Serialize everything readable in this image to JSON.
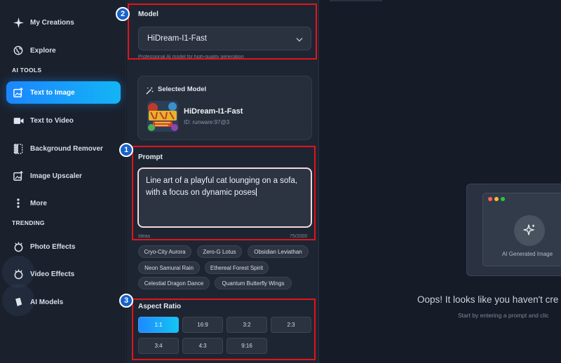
{
  "sidebar": {
    "items": [
      {
        "label": "My Creations",
        "icon": "sparkle-icon"
      },
      {
        "label": "Explore",
        "icon": "globe-icon"
      },
      {
        "label": "Text to Image",
        "icon": "image-add-icon",
        "active": true
      },
      {
        "label": "Text to Video",
        "icon": "video-icon"
      },
      {
        "label": "Background Remover",
        "icon": "bg-remove-icon"
      },
      {
        "label": "Image Upscaler",
        "icon": "upscale-icon"
      },
      {
        "label": "More",
        "icon": "more-vertical-icon"
      },
      {
        "label": "Photo Effects",
        "icon": "effects-icon"
      },
      {
        "label": "Video Effects",
        "icon": "effects-icon"
      },
      {
        "label": "AI Models",
        "icon": "model-cube-icon"
      }
    ],
    "section_ai_tools": "AI TOOLS",
    "section_trending": "TRENDING"
  },
  "model": {
    "label": "Model",
    "selected": "HiDream-I1-Fast",
    "description": "Professional AI model for high-quality generation"
  },
  "selected_model": {
    "heading": "Selected Model",
    "name": "HiDream-I1-Fast",
    "id": "ID: runware:97@3"
  },
  "prompt": {
    "label": "Prompt",
    "line1": "Line art of a playful cat lounging on a sofa,",
    "line2": "with a focus on dynamic poses",
    "ideas_label": "Ideas",
    "char_count": "75/2000"
  },
  "suggestions": [
    "Cryo-City Aurora",
    "Zero-G Lotus",
    "Obsidian Leviathan",
    "Neon Samurai Rain",
    "Ethereal Forest Spirit",
    "Celestial Dragon Dance",
    "Quantum Butterfly Wings"
  ],
  "aspect_ratio": {
    "label": "Aspect Ratio",
    "options": [
      "1:1",
      "16:9",
      "3:2",
      "2:3",
      "3:4",
      "4:3",
      "9:16"
    ],
    "selected": "1:1"
  },
  "annotations": [
    "1",
    "2",
    "3"
  ],
  "preview": {
    "caption": "AI Generated Image",
    "empty_title": "Oops! It looks like you haven't cre",
    "empty_hint": "Start by entering a prompt and clic"
  },
  "colors": {
    "accent": "#1b86ff",
    "accent_end": "#14b4f5",
    "highlight_box": "#e1141c",
    "badge": "#1662c9"
  }
}
